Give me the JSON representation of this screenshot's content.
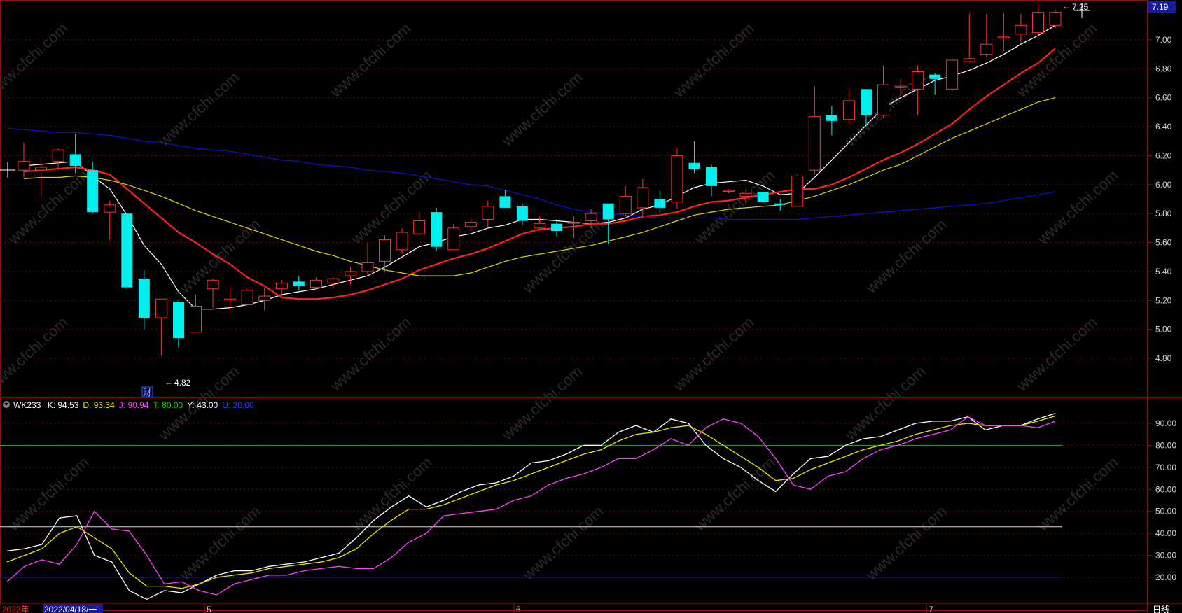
{
  "price_panel": {
    "price_axis_ticks": [
      "7.00",
      "6.80",
      "6.60",
      "6.40",
      "6.20",
      "6.00",
      "5.80",
      "5.60",
      "5.40",
      "5.20",
      "5.00",
      "4.80"
    ],
    "current_price_badge": "7.19",
    "high_marker": "7.25",
    "low_marker": "4.82",
    "event_tag": "财"
  },
  "indicator_panel": {
    "name": "WK233",
    "values": [
      {
        "label": "K: 94.53",
        "color": "#ffffff"
      },
      {
        "label": "D: 93.34",
        "color": "#e8e800"
      },
      {
        "label": "J: 90.94",
        "color": "#ff40ff"
      },
      {
        "label": "T: 80.00",
        "color": "#00e000"
      },
      {
        "label": "Y: 43.00",
        "color": "#ffffff"
      },
      {
        "label": "U: 20.00",
        "color": "#2040ff"
      }
    ],
    "axis_ticks": [
      "90.00",
      "80.00",
      "70.00",
      "60.00",
      "50.00",
      "40.00",
      "30.00",
      "20.00"
    ]
  },
  "time_axis": {
    "year_label": "2022年",
    "cursor_date": "2022/04/18/一",
    "month_labels": [
      "5",
      "6",
      "7"
    ],
    "period": "日线"
  },
  "watermark": "www.cfchi.com",
  "chart_data": [
    {
      "type": "candlestick",
      "title": "",
      "ylim": [
        4.7,
        7.3
      ],
      "candles": [
        {
          "o": 6.1,
          "h": 6.29,
          "l": 6.05,
          "c": 6.16
        },
        {
          "o": 6.1,
          "h": 6.16,
          "l": 5.92,
          "c": 6.12
        },
        {
          "o": 6.16,
          "h": 6.25,
          "l": 6.1,
          "c": 6.24
        },
        {
          "o": 6.21,
          "h": 6.35,
          "l": 6.08,
          "c": 6.13
        },
        {
          "o": 6.1,
          "h": 6.16,
          "l": 5.8,
          "c": 5.81
        },
        {
          "o": 5.81,
          "h": 5.89,
          "l": 5.62,
          "c": 5.86
        },
        {
          "o": 5.8,
          "h": 5.8,
          "l": 5.27,
          "c": 5.29
        },
        {
          "o": 5.35,
          "h": 5.41,
          "l": 5.0,
          "c": 5.08
        },
        {
          "o": 5.08,
          "h": 5.21,
          "l": 4.82,
          "c": 5.21
        },
        {
          "o": 5.19,
          "h": 5.2,
          "l": 4.87,
          "c": 4.94
        },
        {
          "o": 4.98,
          "h": 5.24,
          "l": 4.98,
          "c": 5.16
        },
        {
          "o": 5.28,
          "h": 5.35,
          "l": 5.15,
          "c": 5.34
        },
        {
          "o": 5.21,
          "h": 5.3,
          "l": 5.13,
          "c": 5.21
        },
        {
          "o": 5.17,
          "h": 5.28,
          "l": 5.17,
          "c": 5.27
        },
        {
          "o": 5.2,
          "h": 5.29,
          "l": 5.13,
          "c": 5.23
        },
        {
          "o": 5.28,
          "h": 5.34,
          "l": 5.23,
          "c": 5.32
        },
        {
          "o": 5.33,
          "h": 5.37,
          "l": 5.27,
          "c": 5.3
        },
        {
          "o": 5.29,
          "h": 5.36,
          "l": 5.27,
          "c": 5.34
        },
        {
          "o": 5.32,
          "h": 5.36,
          "l": 5.28,
          "c": 5.35
        },
        {
          "o": 5.37,
          "h": 5.43,
          "l": 5.31,
          "c": 5.4
        },
        {
          "o": 5.4,
          "h": 5.6,
          "l": 5.37,
          "c": 5.46
        },
        {
          "o": 5.47,
          "h": 5.65,
          "l": 5.4,
          "c": 5.62
        },
        {
          "o": 5.55,
          "h": 5.7,
          "l": 5.52,
          "c": 5.67
        },
        {
          "o": 5.66,
          "h": 5.81,
          "l": 5.65,
          "c": 5.75
        },
        {
          "o": 5.81,
          "h": 5.84,
          "l": 5.54,
          "c": 5.57
        },
        {
          "o": 5.55,
          "h": 5.73,
          "l": 5.55,
          "c": 5.7
        },
        {
          "o": 5.71,
          "h": 5.77,
          "l": 5.68,
          "c": 5.74
        },
        {
          "o": 5.76,
          "h": 5.89,
          "l": 5.71,
          "c": 5.85
        },
        {
          "o": 5.92,
          "h": 5.96,
          "l": 5.84,
          "c": 5.84
        },
        {
          "o": 5.85,
          "h": 5.87,
          "l": 5.72,
          "c": 5.75
        },
        {
          "o": 5.7,
          "h": 5.78,
          "l": 5.7,
          "c": 5.73
        },
        {
          "o": 5.73,
          "h": 5.76,
          "l": 5.64,
          "c": 5.68
        },
        {
          "o": 5.74,
          "h": 5.78,
          "l": 5.63,
          "c": 5.74
        },
        {
          "o": 5.75,
          "h": 5.83,
          "l": 5.7,
          "c": 5.8
        },
        {
          "o": 5.87,
          "h": 5.87,
          "l": 5.59,
          "c": 5.76
        },
        {
          "o": 5.8,
          "h": 5.99,
          "l": 5.78,
          "c": 5.92
        },
        {
          "o": 5.84,
          "h": 6.04,
          "l": 5.77,
          "c": 5.98
        },
        {
          "o": 5.9,
          "h": 5.96,
          "l": 5.8,
          "c": 5.84
        },
        {
          "o": 5.88,
          "h": 6.25,
          "l": 5.83,
          "c": 6.2
        },
        {
          "o": 6.15,
          "h": 6.3,
          "l": 6.08,
          "c": 6.11
        },
        {
          "o": 6.12,
          "h": 6.14,
          "l": 5.92,
          "c": 5.99
        },
        {
          "o": 5.96,
          "h": 5.97,
          "l": 5.94,
          "c": 5.96
        },
        {
          "o": 5.92,
          "h": 5.97,
          "l": 5.86,
          "c": 5.94
        },
        {
          "o": 5.95,
          "h": 5.95,
          "l": 5.87,
          "c": 5.88
        },
        {
          "o": 5.87,
          "h": 5.9,
          "l": 5.82,
          "c": 5.86
        },
        {
          "o": 5.85,
          "h": 6.07,
          "l": 5.85,
          "c": 6.06
        },
        {
          "o": 6.1,
          "h": 6.68,
          "l": 6.07,
          "c": 6.47
        },
        {
          "o": 6.48,
          "h": 6.54,
          "l": 6.34,
          "c": 6.44
        },
        {
          "o": 6.45,
          "h": 6.67,
          "l": 6.41,
          "c": 6.58
        },
        {
          "o": 6.66,
          "h": 6.66,
          "l": 6.4,
          "c": 6.48
        },
        {
          "o": 6.48,
          "h": 6.82,
          "l": 6.46,
          "c": 6.69
        },
        {
          "o": 6.67,
          "h": 6.73,
          "l": 6.6,
          "c": 6.68
        },
        {
          "o": 6.66,
          "h": 6.82,
          "l": 6.48,
          "c": 6.78
        },
        {
          "o": 6.76,
          "h": 6.77,
          "l": 6.62,
          "c": 6.73
        },
        {
          "o": 6.66,
          "h": 6.88,
          "l": 6.64,
          "c": 6.86
        },
        {
          "o": 6.85,
          "h": 7.18,
          "l": 6.84,
          "c": 6.87
        },
        {
          "o": 6.9,
          "h": 7.18,
          "l": 6.88,
          "c": 6.97
        },
        {
          "o": 7.02,
          "h": 7.19,
          "l": 6.92,
          "c": 7.02
        },
        {
          "o": 7.04,
          "h": 7.18,
          "l": 6.97,
          "c": 7.1
        },
        {
          "o": 7.05,
          "h": 7.25,
          "l": 7.03,
          "c": 7.19
        },
        {
          "o": 7.1,
          "h": 7.21,
          "l": 7.08,
          "c": 7.19
        }
      ],
      "moving_averages": [
        {
          "color": "#ffffff",
          "values": [
            6.13,
            6.14,
            6.15,
            6.16,
            6.06,
            5.97,
            5.79,
            5.58,
            5.45,
            5.26,
            5.14,
            5.14,
            5.15,
            5.17,
            5.2,
            5.24,
            5.26,
            5.28,
            5.31,
            5.34,
            5.37,
            5.43,
            5.5,
            5.57,
            5.6,
            5.64,
            5.66,
            5.7,
            5.72,
            5.76,
            5.76,
            5.75,
            5.74,
            5.73,
            5.74,
            5.77,
            5.83,
            5.86,
            5.92,
            5.98,
            6.01,
            6.02,
            6.03,
            5.99,
            5.93,
            5.94,
            6.05,
            6.17,
            6.29,
            6.41,
            6.53,
            6.6,
            6.66,
            6.72,
            6.75,
            6.79,
            6.84,
            6.9,
            6.97,
            7.03,
            7.1
          ]
        },
        {
          "color": "#ff2020",
          "values": [
            6.09,
            6.1,
            6.11,
            6.12,
            6.1,
            6.07,
            5.97,
            5.87,
            5.77,
            5.67,
            5.6,
            5.52,
            5.45,
            5.36,
            5.3,
            5.22,
            5.21,
            5.21,
            5.22,
            5.24,
            5.27,
            5.31,
            5.35,
            5.41,
            5.45,
            5.49,
            5.52,
            5.56,
            5.61,
            5.66,
            5.69,
            5.7,
            5.71,
            5.73,
            5.73,
            5.75,
            5.78,
            5.79,
            5.81,
            5.85,
            5.88,
            5.89,
            5.91,
            5.93,
            5.95,
            5.97,
            5.97,
            6.0,
            6.05,
            6.11,
            6.17,
            6.22,
            6.28,
            6.35,
            6.42,
            6.52,
            6.61,
            6.69,
            6.77,
            6.84,
            6.94
          ]
        },
        {
          "color": "#d8d800",
          "values": [
            6.04,
            6.05,
            6.05,
            6.06,
            6.05,
            6.03,
            6.0,
            5.96,
            5.92,
            5.87,
            5.82,
            5.78,
            5.74,
            5.7,
            5.66,
            5.62,
            5.58,
            5.54,
            5.51,
            5.47,
            5.44,
            5.41,
            5.39,
            5.37,
            5.37,
            5.37,
            5.39,
            5.43,
            5.47,
            5.5,
            5.52,
            5.54,
            5.56,
            5.58,
            5.61,
            5.64,
            5.67,
            5.71,
            5.75,
            5.79,
            5.81,
            5.83,
            5.84,
            5.85,
            5.86,
            5.89,
            5.92,
            5.96,
            6.0,
            6.05,
            6.1,
            6.14,
            6.2,
            6.26,
            6.32,
            6.37,
            6.42,
            6.47,
            6.52,
            6.57,
            6.6
          ]
        },
        {
          "color": "#1010d0",
          "values": [
            6.38,
            6.37,
            6.36,
            6.36,
            6.35,
            6.34,
            6.32,
            6.3,
            6.29,
            6.27,
            6.25,
            6.24,
            6.23,
            6.21,
            6.19,
            6.17,
            6.16,
            6.14,
            6.13,
            6.12,
            6.1,
            6.09,
            6.08,
            6.06,
            6.04,
            6.02,
            6.0,
            5.99,
            5.96,
            5.93,
            5.9,
            5.86,
            5.83,
            5.81,
            5.8,
            5.79,
            5.78,
            5.77,
            5.77,
            5.77,
            5.77,
            5.76,
            5.76,
            5.76,
            5.76,
            5.76,
            5.77,
            5.78,
            5.79,
            5.8,
            5.81,
            5.82,
            5.83,
            5.84,
            5.85,
            5.86,
            5.87,
            5.89,
            5.91,
            5.93,
            5.95
          ]
        }
      ]
    },
    {
      "type": "line",
      "title": "WK233",
      "ylim": [
        15,
        100
      ],
      "series": [
        {
          "name": "K",
          "color": "#ffffff",
          "values": [
            32,
            33,
            35,
            47,
            48,
            30,
            27,
            14,
            10,
            14,
            13,
            17,
            21,
            23,
            23,
            25,
            26,
            27,
            29,
            31,
            38,
            46,
            52,
            57,
            52,
            55,
            59,
            62,
            63,
            66,
            72,
            73,
            76,
            80,
            80,
            86,
            89,
            86,
            92,
            90,
            80,
            74,
            70,
            64,
            59,
            67,
            74,
            75,
            80,
            83,
            84,
            87,
            90,
            91,
            91,
            93,
            87,
            89,
            89,
            92,
            94.53
          ]
        },
        {
          "name": "D",
          "color": "#e8e800",
          "values": [
            27,
            30,
            33,
            40,
            43,
            38,
            33,
            22,
            16,
            16,
            15,
            17,
            20,
            21,
            22,
            24,
            25,
            26,
            27,
            29,
            33,
            40,
            46,
            51,
            51,
            53,
            56,
            59,
            62,
            64,
            67,
            70,
            73,
            76,
            78,
            82,
            85,
            86,
            88,
            89,
            85,
            80,
            75,
            70,
            64,
            65,
            69,
            72,
            75,
            78,
            80,
            82,
            85,
            87,
            89,
            90,
            89,
            89,
            89,
            91,
            93.34
          ]
        },
        {
          "name": "J",
          "color": "#ff40ff",
          "values": [
            18,
            25,
            28,
            26,
            35,
            50,
            42,
            41,
            30,
            17,
            18,
            14,
            12,
            17,
            19,
            21,
            21,
            23,
            24,
            25,
            24,
            24,
            29,
            36,
            40,
            48,
            49,
            50,
            51,
            55,
            57,
            62,
            65,
            67,
            70,
            74,
            74,
            78,
            83,
            80,
            88,
            92,
            90,
            84,
            74,
            62,
            60,
            66,
            68,
            74,
            78,
            80,
            83,
            85,
            87,
            93,
            89,
            89,
            89,
            88,
            90.94
          ]
        }
      ],
      "reference_lines": [
        {
          "name": "T",
          "value": 80,
          "color": "#00c000"
        },
        {
          "name": "Y",
          "value": 43,
          "color": "#d8d8d8"
        },
        {
          "name": "U",
          "value": 20,
          "color": "#1a1adc"
        }
      ]
    }
  ]
}
